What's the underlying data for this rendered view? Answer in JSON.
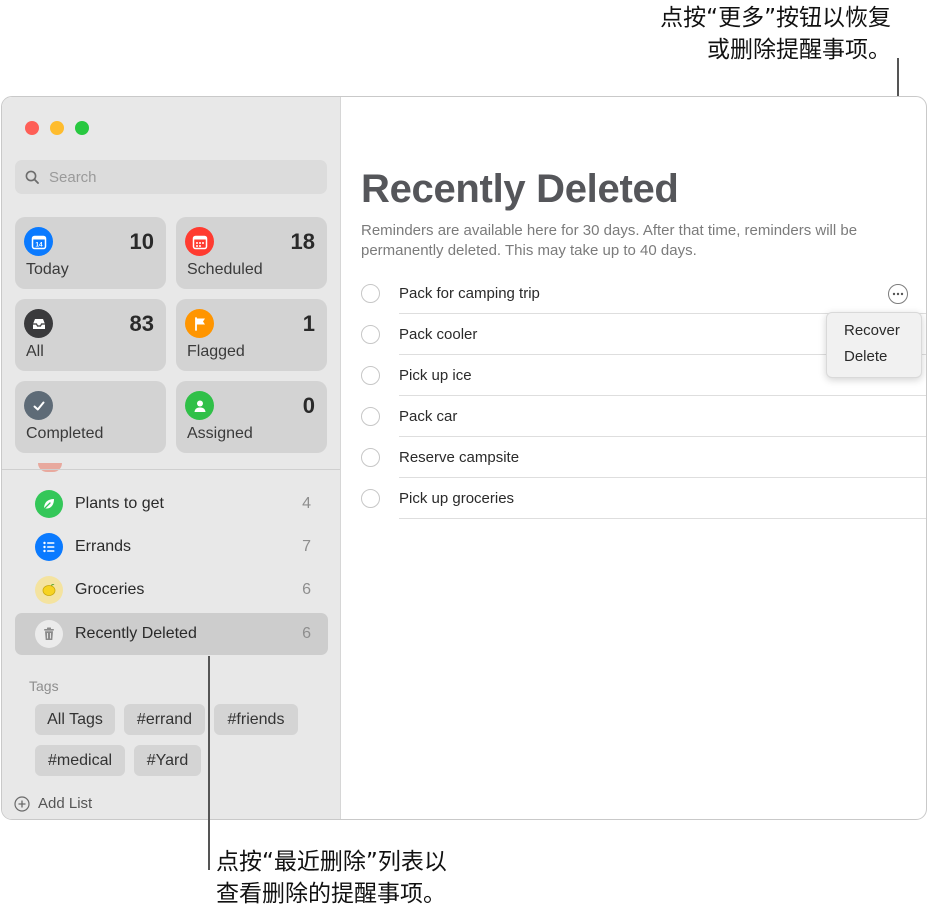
{
  "callouts": {
    "top_line1": "点按“更多”按钮以恢复",
    "top_line2": "或删除提醒事项。",
    "bottom_line1": "点按“最近删除”列表以",
    "bottom_line2": "查看删除的提醒事项。"
  },
  "sidebar": {
    "search": {
      "placeholder": "Search"
    },
    "smart_lists": [
      {
        "label": "Today",
        "count": "10",
        "icon": "calendar-today-icon",
        "color": "#0a7aff"
      },
      {
        "label": "Scheduled",
        "count": "18",
        "icon": "calendar-icon",
        "color": "#ff3b30"
      },
      {
        "label": "All",
        "count": "83",
        "icon": "tray-icon",
        "color": "#3a3a3c"
      },
      {
        "label": "Flagged",
        "count": "1",
        "icon": "flag-icon",
        "color": "#ff9500"
      },
      {
        "label": "Completed",
        "count": "",
        "icon": "checkmark-icon",
        "color": "#5e6b77"
      },
      {
        "label": "Assigned",
        "count": "0",
        "icon": "person-icon",
        "color": "#30c048"
      }
    ],
    "lists": [
      {
        "label": "Plants to get",
        "count": "4",
        "icon": "leaf-icon",
        "color": "#34c759"
      },
      {
        "label": "Errands",
        "count": "7",
        "icon": "list-bullet-icon",
        "color": "#0a7aff"
      },
      {
        "label": "Groceries",
        "count": "6",
        "icon": "lemon-icon",
        "color": "#f4e3a0"
      },
      {
        "label": "Recently Deleted",
        "count": "6",
        "icon": "trash-icon",
        "color": "#ebebeb"
      }
    ],
    "tags_header": "Tags",
    "tags": [
      "All Tags",
      "#errand",
      "#friends",
      "#medical",
      "#Yard"
    ],
    "add_list_label": "Add List"
  },
  "main": {
    "title": "Recently Deleted",
    "description": "Reminders are available here for 30 days. After that time, reminders will be permanently deleted. This may take up to 40 days.",
    "reminders": [
      "Pack for camping trip",
      "Pack cooler",
      "Pick up ice",
      "Pack car",
      "Reserve campsite",
      "Pick up groceries"
    ],
    "menu": {
      "recover": "Recover",
      "delete": "Delete"
    }
  }
}
